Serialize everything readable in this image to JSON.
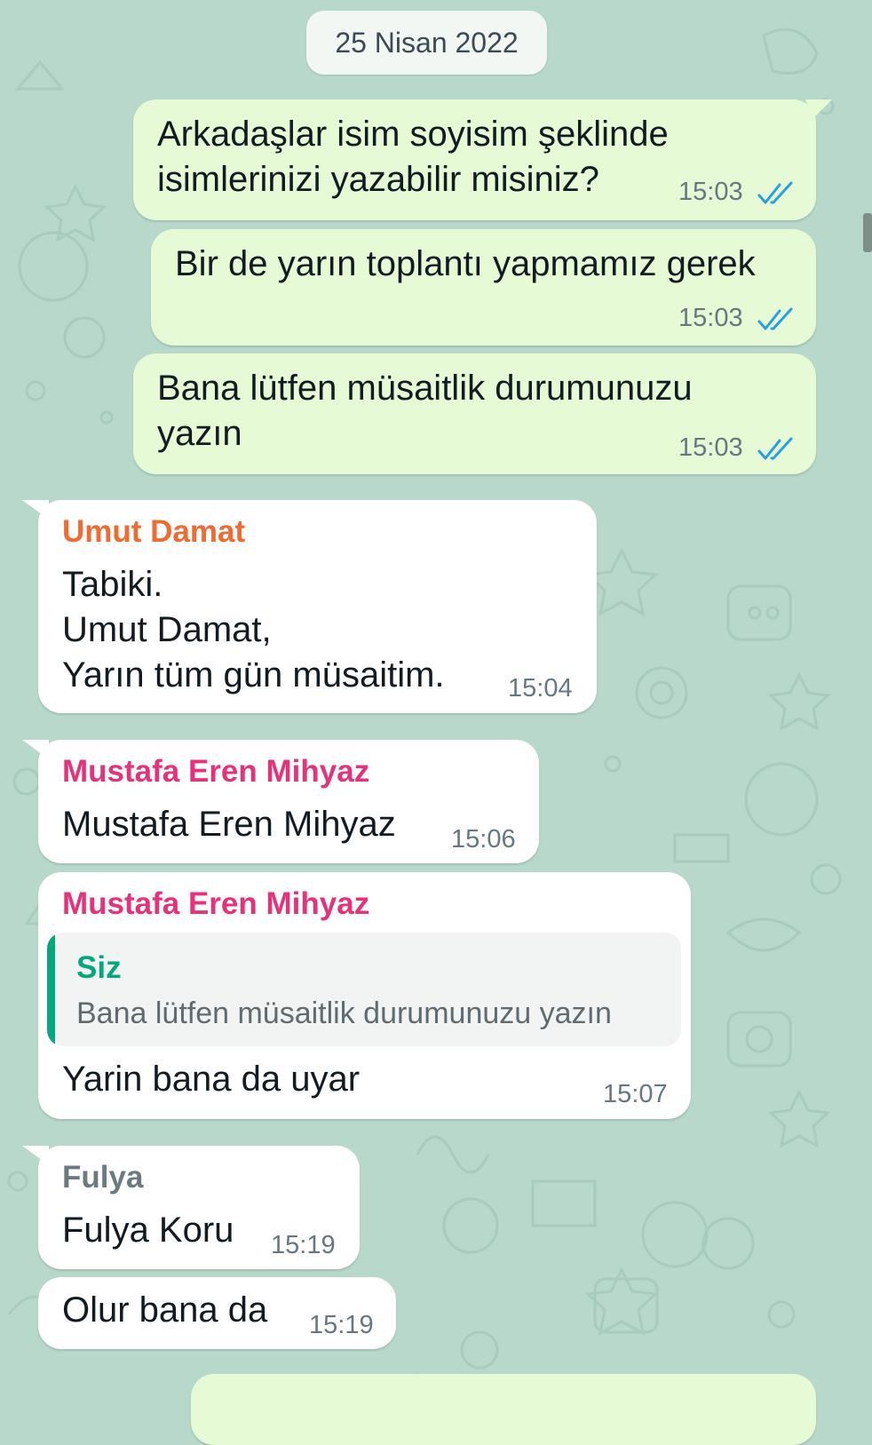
{
  "colors": {
    "wallpaper": "#b7d8cb",
    "outgoing_bubble": "#e6fbd5",
    "incoming_bubble": "#ffffff",
    "read_ticks": "#2a9fe0",
    "sender_umut": "#ee6b32",
    "sender_mustafa": "#e5337b",
    "sender_fulya": "#6b7a80",
    "quote_accent": "#06a67e"
  },
  "chat": {
    "date_badge": "25 Nisan 2022",
    "messages": [
      {
        "direction": "out",
        "text": "Arkadaşlar isim soyisim şeklinde\nisimlerinizi yazabilir misiniz?",
        "time": "15:03",
        "status_icon": "double-check-read-icon"
      },
      {
        "direction": "out",
        "text": "Bir de yarın toplantı yapmamız gerek",
        "time": "15:03",
        "status_icon": "double-check-read-icon"
      },
      {
        "direction": "out",
        "text": "Bana lütfen müsaitlik durumunuzu\nyazın",
        "time": "15:03",
        "status_icon": "double-check-read-icon"
      },
      {
        "direction": "in",
        "sender": "Umut Damat",
        "text": "Tabiki.\nUmut Damat,\nYarın tüm gün müsaitim.",
        "time": "15:04"
      },
      {
        "direction": "in",
        "sender": "Mustafa Eren Mihyaz",
        "text": "Mustafa Eren Mihyaz",
        "time": "15:06"
      },
      {
        "direction": "in",
        "sender": "Mustafa Eren Mihyaz",
        "quote": {
          "author": "Siz",
          "text": "Bana lütfen müsaitlik durumunuzu yazın"
        },
        "text": "Yarin bana da uyar",
        "time": "15:07"
      },
      {
        "direction": "in",
        "sender": "Fulya",
        "text": "Fulya Koru",
        "time": "15:19"
      },
      {
        "direction": "in",
        "text": "Olur bana da",
        "time": "15:19"
      }
    ]
  }
}
